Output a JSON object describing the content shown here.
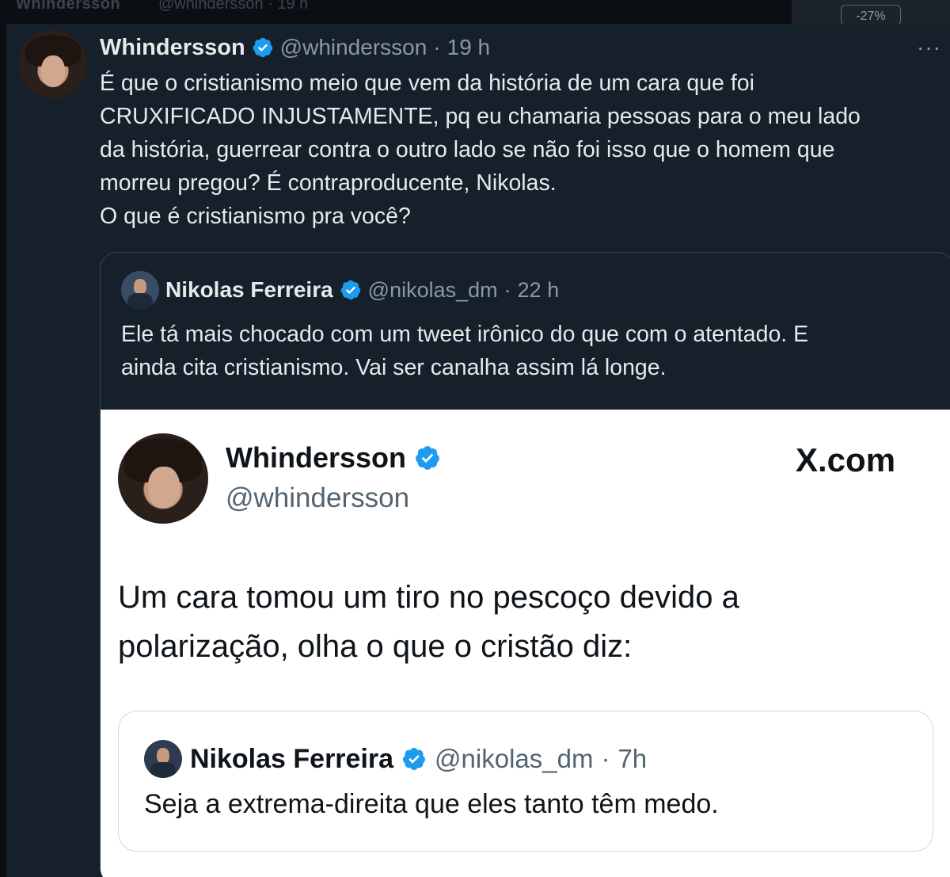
{
  "background_ghost": {
    "name": "Whindersson",
    "handle": "@whindersson · 19 h",
    "pill": "-27%"
  },
  "main_tweet": {
    "name": "Whindersson",
    "handle": "@whindersson",
    "separator": "·",
    "time": "19 h",
    "more": "···",
    "lines": [
      "É que o cristianismo meio que vem da história de um cara que foi",
      "CRUXIFICADO INJUSTAMENTE, pq eu chamaria pessoas para o meu lado",
      "da história, guerrear contra o outro lado se não foi isso que o homem que",
      "morreu pregou? É contraproducente, Nikolas.",
      "O que é cristianismo pra você?"
    ]
  },
  "quoted_tweet": {
    "name": "Nikolas Ferreira",
    "handle": "@nikolas_dm",
    "separator": "·",
    "time": "22 h",
    "lines": [
      "Ele tá mais chocado com um tweet irônico do que com o atentado. E",
      "ainda cita cristianismo. Vai ser canalha assim lá longe."
    ]
  },
  "screenshot_card": {
    "name": "Whindersson",
    "handle": "@whindersson",
    "brand": "X.com",
    "lines": [
      "Um cara tomou um tiro no pescoço devido a",
      "polarização, olha o que o cristão diz:"
    ],
    "inner_quote": {
      "name": "Nikolas Ferreira",
      "handle": "@nikolas_dm",
      "separator": "·",
      "time": "7h",
      "text": "Seja a extrema-direita que eles tanto têm medo."
    }
  },
  "colors": {
    "background": "#15202b",
    "verified": "#1d9bf0",
    "text_primary": "#e7e9ea",
    "text_secondary": "#8b98a5"
  },
  "icons": [
    "verified-badge-icon",
    "more-options-icon"
  ]
}
